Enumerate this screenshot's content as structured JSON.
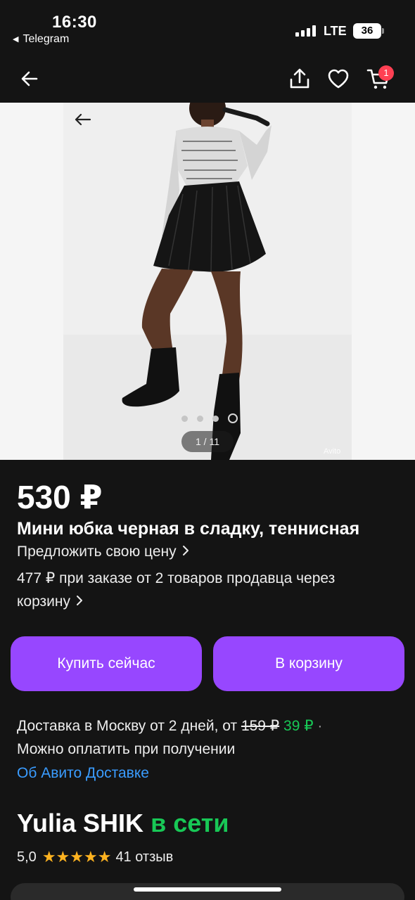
{
  "status_bar": {
    "time": "16:30",
    "back_app": "Telegram",
    "network": "LTE",
    "battery": "36"
  },
  "nav": {
    "icons": [
      "back-arrow-icon",
      "share-icon",
      "heart-icon",
      "cart-icon"
    ],
    "cart_count": "1"
  },
  "gallery": {
    "counter": "1 / 11",
    "watermark": "Avito",
    "dots_total": 4,
    "active_dot": 4
  },
  "product": {
    "price": "530 ₽",
    "title": "Мини юбка черная в сладку, теннисная",
    "offer_price": "Предложить свою цену",
    "bundle_text": "477 ₽ при заказе от 2 товаров продавца через корзину"
  },
  "actions": {
    "buy_now": "Купить сейчас",
    "add_to_cart": "В корзину"
  },
  "delivery": {
    "text": "Доставка в Москву от 2 дней, от",
    "old_price": "159 ₽",
    "new_price": "39 ₽",
    "separator": "·",
    "payment": "Можно оплатить при получении",
    "about_link": "Об Авито Доставке"
  },
  "seller": {
    "name": "Yulia SHIK",
    "status": "в сети",
    "rating": "5,0",
    "stars": "★★★★★",
    "reviews": "41 отзыв"
  },
  "colors": {
    "background": "#141414",
    "accent": "#9747ff",
    "online": "#18c856",
    "link": "#3a9cff",
    "badge": "#ff4053",
    "star": "#ffb320"
  }
}
